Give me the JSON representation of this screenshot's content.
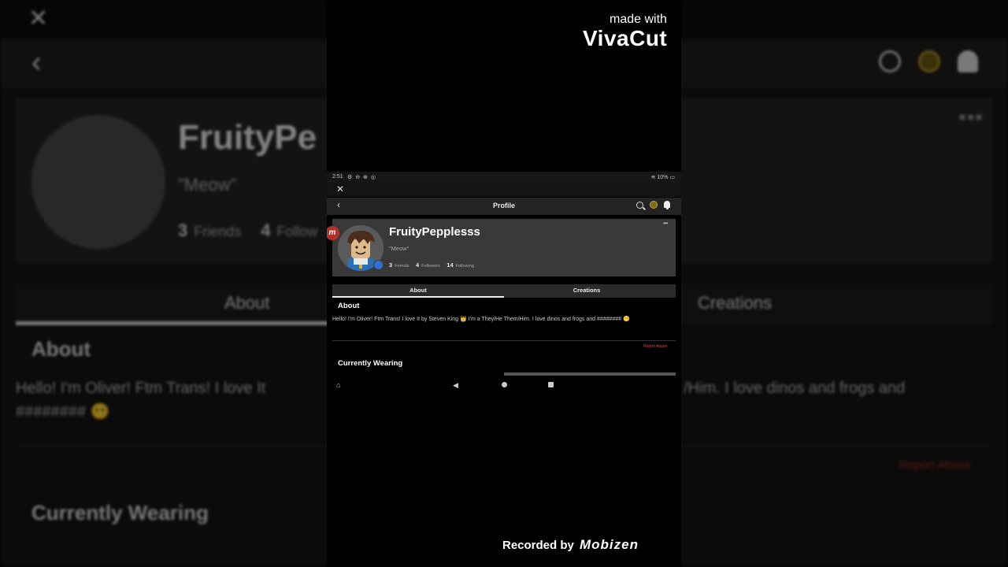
{
  "watermark": {
    "made_with": "made with",
    "brand": "VivaCut",
    "recorded_by": "Recorded by",
    "recorder": "Mobizen"
  },
  "status_bar": {
    "time": "2:51",
    "battery": "10%"
  },
  "header": {
    "title": "Profile",
    "close_glyph": "✕",
    "back_glyph": "‹",
    "icons": [
      "search-icon",
      "robux-icon",
      "notification-bell-icon"
    ]
  },
  "profile": {
    "username": "FruityPepplesss",
    "status": "\"Meow\"",
    "premium_badge": "m",
    "menu_glyph": "•••",
    "stats": [
      {
        "count": "3",
        "label": "Friends"
      },
      {
        "count": "4",
        "label": "Followers"
      },
      {
        "count": "14",
        "label": "Following"
      }
    ]
  },
  "tabs": {
    "about": "About",
    "creations": "Creations"
  },
  "about": {
    "heading": "About",
    "bio": "Hello! I'm Oliver! Ftm Trans! I love It by Steven King 👑 I'm a They/He Them/Him. I love dinos and frogs and ######## 😶",
    "report_abuse": "Report Abuse"
  },
  "currently_wearing": {
    "heading": "Currently Wearing"
  },
  "background": {
    "name": "FruityPe",
    "status": "\"Meow\"",
    "stat1_count": "3",
    "stat1_label": "Friends",
    "stat2_count": "4",
    "stat2_label": "Follow",
    "tab_about": "About",
    "tab_creations": "Creations",
    "about_heading": "About",
    "bio_line1": "Hello! I'm Oliver! Ftm Trans! I love It",
    "bio_line1_right": "/Him. I love dinos and frogs and",
    "bio_line2": "######## 😶",
    "report": "Report Abuse",
    "wearing": "Currently Wearing"
  }
}
